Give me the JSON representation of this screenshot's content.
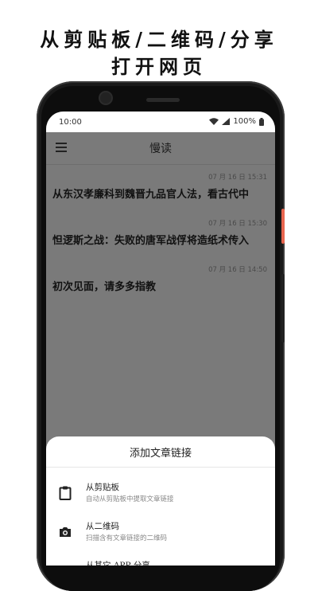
{
  "headline": {
    "line1": "从剪贴板/二维码/分享",
    "line2": "打开网页"
  },
  "status": {
    "time": "10:00",
    "battery": "100%"
  },
  "app": {
    "title": "慢读"
  },
  "articles": [
    {
      "time": "07 月 16 日 15:31",
      "title": "从东汉孝廉科到魏晋九品官人法，看古代中"
    },
    {
      "time": "07 月 16 日 15:30",
      "title": "怛逻斯之战：失败的唐军战俘将造纸术传入"
    },
    {
      "time": "07 月 16 日 14:50",
      "title": "初次见面，请多多指教"
    }
  ],
  "sheet": {
    "title": "添加文章链接",
    "options": [
      {
        "label": "从剪贴板",
        "desc": "自动从剪贴板中提取文章链接",
        "icon": "clipboard-icon"
      },
      {
        "label": "从二维码",
        "desc": "扫描含有文章链接的二维码",
        "icon": "camera-icon"
      },
      {
        "label": "从其它 APP 分享",
        "desc": "",
        "icon": "share-icon"
      }
    ]
  },
  "colors": {
    "power_button": "#e8664f",
    "scrim": "#7a7a7a"
  }
}
